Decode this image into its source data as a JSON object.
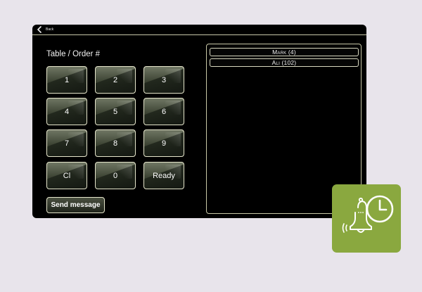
{
  "topbar": {
    "back_label": "Back"
  },
  "numpad": {
    "title": "Table / Order #",
    "keys": [
      "1",
      "2",
      "3",
      "4",
      "5",
      "6",
      "7",
      "8",
      "9",
      "Cl",
      "0",
      "Ready"
    ]
  },
  "send_button": {
    "label": "Send message"
  },
  "recipients": [
    {
      "label": "Mark (4)"
    },
    {
      "label": "Ali (102)"
    }
  ],
  "colors": {
    "page_background": "#e8e4eb",
    "device_background": "#000000",
    "key_border": "#e6e6cc",
    "notification_tile": "#8aa83f"
  },
  "icons": {
    "back": "chevron-left-icon",
    "notification": "bell-clock-icon"
  }
}
